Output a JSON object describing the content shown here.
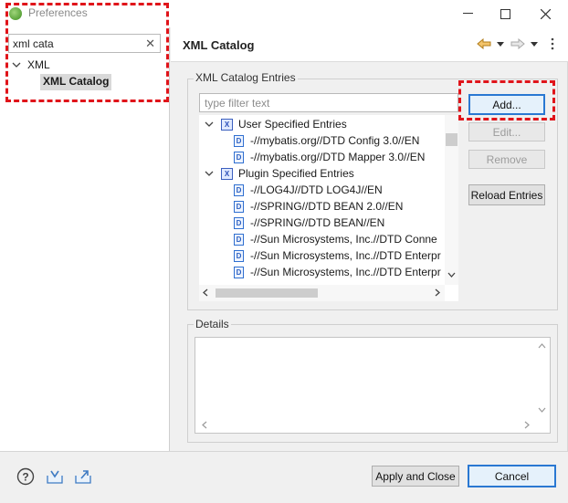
{
  "window": {
    "title": "Preferences",
    "minimize_glyph": "—",
    "maximize_glyph": "☐",
    "close_glyph": "✕"
  },
  "left": {
    "search_value": "xml cata",
    "clear_glyph": "✕",
    "tree": {
      "parent": "XML",
      "child": "XML Catalog"
    }
  },
  "header": {
    "page_title": "XML Catalog",
    "icons": [
      "back-arrow-icon",
      "back-dropdown-icon",
      "forward-arrow-icon",
      "forward-dropdown-icon",
      "view-menu-icon"
    ]
  },
  "catalog": {
    "group_label": "XML Catalog Entries",
    "filter_placeholder": "type filter text",
    "user_group": "User Specified Entries",
    "user_entries": [
      "-//mybatis.org//DTD Config 3.0//EN",
      "-//mybatis.org//DTD Mapper 3.0//EN"
    ],
    "plugin_group": "Plugin Specified Entries",
    "plugin_entries": [
      "-//LOG4J//DTD LOG4J//EN",
      "-//SPRING//DTD BEAN 2.0//EN",
      "-//SPRING//DTD BEAN//EN",
      "-//Sun Microsystems, Inc.//DTD Conne",
      "-//Sun Microsystems, Inc.//DTD Enterpr",
      "-//Sun Microsystems, Inc.//DTD Enterpr"
    ],
    "buttons": {
      "add": "Add...",
      "edit": "Edit...",
      "remove": "Remove",
      "reload": "Reload Entries"
    }
  },
  "details": {
    "group_label": "Details"
  },
  "footer": {
    "apply_close": "Apply and Close",
    "cancel": "Cancel",
    "icons": [
      "help-icon",
      "import-icon",
      "export-icon"
    ]
  },
  "colors": {
    "highlight_dash": "#e0141a",
    "default_button_border": "#2a78d2",
    "selected_bg": "#d9d9d9",
    "accent_green": "#5aa33a"
  }
}
